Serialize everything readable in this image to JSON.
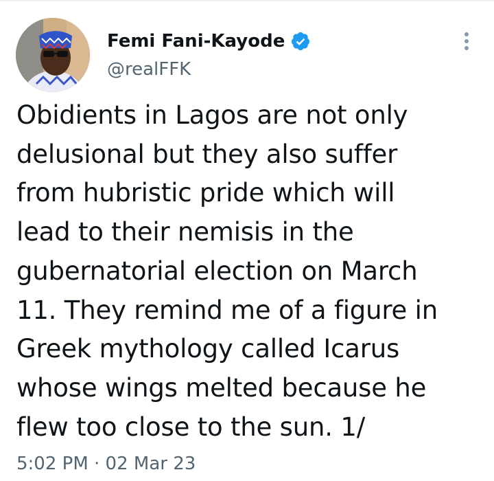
{
  "author": {
    "display_name": "Femi Fani-Kayode",
    "handle": "@realFFK",
    "verified_icon": "verified-badge-icon",
    "avatar_icon": "profile-photo"
  },
  "menu": {
    "icon": "more-options-icon"
  },
  "tweet": {
    "lines": [
      "Obidients in Lagos are not only",
      "delusional but they also suffer",
      "from hubristic pride which will",
      "lead to their nemisis in the",
      "gubernatorial election on March",
      "11. They remind me of a figure in",
      "Greek mythology called Icarus",
      "whose wings melted because he",
      "flew too close to the sun. 1/"
    ]
  },
  "meta": {
    "timestamp": "5:02 PM · 02 Mar 23"
  },
  "colors": {
    "text": "#0f1419",
    "secondary": "#536471",
    "verified": "#1d9bf0"
  }
}
